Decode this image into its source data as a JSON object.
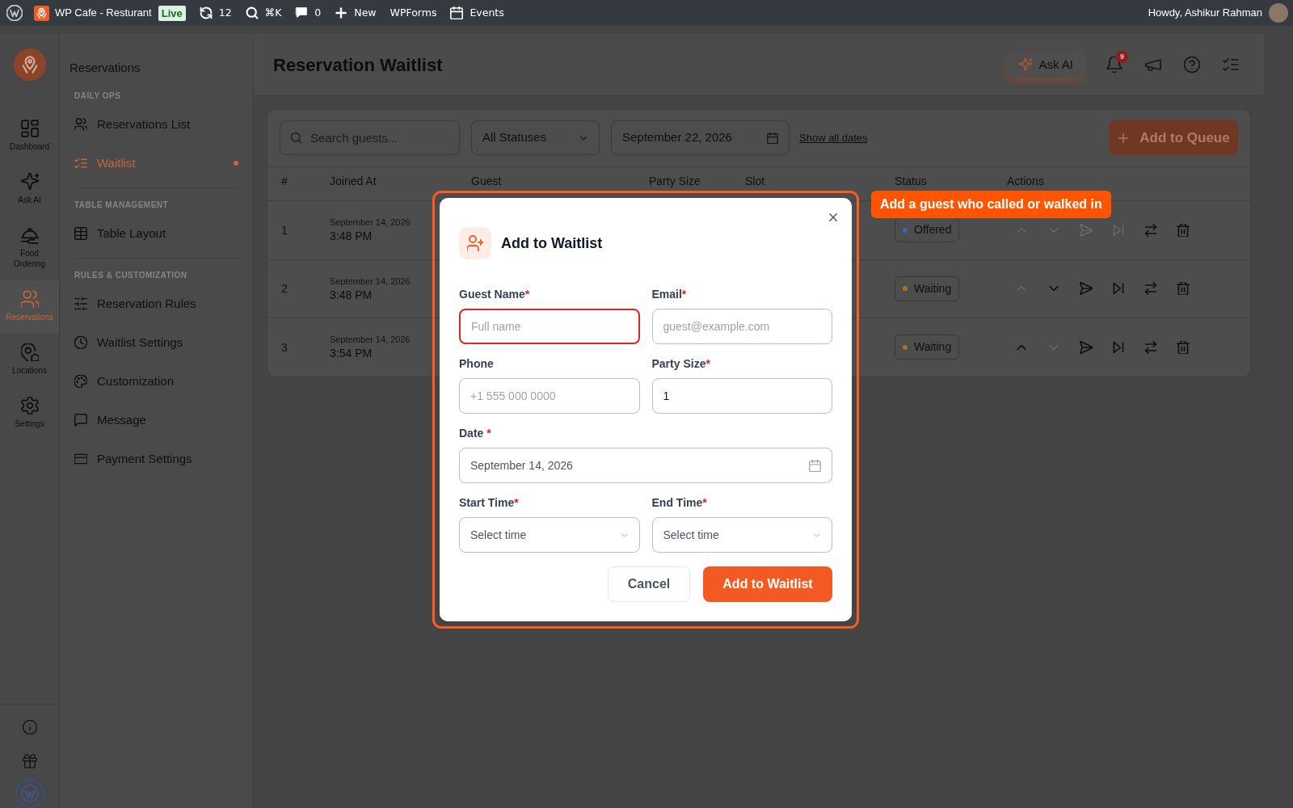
{
  "admin_bar": {
    "site": {
      "name": "WP Cafe - Resturant",
      "badge": "Live"
    },
    "items": [
      {
        "kind": "updates",
        "label": "12"
      },
      {
        "kind": "search",
        "label": "⌘K"
      },
      {
        "kind": "comments",
        "label": "0"
      },
      {
        "kind": "new",
        "label": "New"
      },
      {
        "kind": "link",
        "label": "WPForms"
      },
      {
        "kind": "events",
        "label": "Events"
      }
    ],
    "greeting": "Howdy, Ashikur Rahman"
  },
  "rail": {
    "items": [
      {
        "label": "Dashboard",
        "selected": false
      },
      {
        "label": "Ask AI",
        "selected": false
      },
      {
        "label": "Food Ordering",
        "selected": false
      },
      {
        "label": "Reservations",
        "selected": true
      },
      {
        "label": "Locations",
        "selected": false
      },
      {
        "label": "Settings",
        "selected": false
      }
    ]
  },
  "sidebar": {
    "title": "Reservations",
    "sections": [
      {
        "heading": "DAILY OPS",
        "items": [
          {
            "label": "Reservations List",
            "selected": false
          },
          {
            "label": "Waitlist",
            "selected": true
          }
        ]
      },
      {
        "heading": "TABLE MANAGEMENT",
        "items": [
          {
            "label": "Table Layout",
            "selected": false
          }
        ]
      },
      {
        "heading": "RULES & CUSTOMIZATION",
        "items": [
          {
            "label": "Reservation Rules",
            "selected": false
          },
          {
            "label": "Waitlist Settings",
            "selected": false
          },
          {
            "label": "Customization",
            "selected": false
          },
          {
            "label": "Message",
            "selected": false
          },
          {
            "label": "Payment Settings",
            "selected": false
          }
        ]
      }
    ]
  },
  "header": {
    "title": "Reservation Waitlist",
    "ask_ai": "Ask AI",
    "notification_count": "9"
  },
  "toolbar": {
    "search": {
      "placeholder": "Search guests..."
    },
    "status_filter": "All Statuses",
    "date_filter": "September 22, 2026",
    "show_all_dates": "Show all dates",
    "add_button": "Add to Queue"
  },
  "table": {
    "columns": [
      "#",
      "Joined At",
      "Guest",
      "Party Size",
      "Slot",
      "Status",
      "Actions"
    ],
    "rows": [
      {
        "number": "1",
        "joined_date": "September 14, 2026",
        "joined_time": "3:48 PM",
        "status": {
          "label": "Offered",
          "color": "#4263b8"
        },
        "actions": [
          {
            "kind": "up",
            "disabled": true
          },
          {
            "kind": "down",
            "disabled": true
          },
          {
            "kind": "send",
            "disabled": true
          },
          {
            "kind": "skip",
            "disabled": true
          },
          {
            "kind": "swap",
            "disabled": false
          },
          {
            "kind": "delete",
            "disabled": false
          }
        ]
      },
      {
        "number": "2",
        "joined_date": "September 14, 2026",
        "joined_time": "3:48 PM",
        "status": {
          "label": "Waiting",
          "color": "#a8731f"
        },
        "actions": [
          {
            "kind": "up",
            "disabled": true
          },
          {
            "kind": "down",
            "disabled": false
          },
          {
            "kind": "send",
            "disabled": false
          },
          {
            "kind": "skip",
            "disabled": false
          },
          {
            "kind": "swap",
            "disabled": false
          },
          {
            "kind": "delete",
            "disabled": false
          }
        ]
      },
      {
        "number": "3",
        "joined_date": "September 14, 2026",
        "joined_time": "3:54 PM",
        "status": {
          "label": "Waiting",
          "color": "#a8731f"
        },
        "actions": [
          {
            "kind": "up",
            "disabled": false
          },
          {
            "kind": "down",
            "disabled": true
          },
          {
            "kind": "send",
            "disabled": false
          },
          {
            "kind": "skip",
            "disabled": false
          },
          {
            "kind": "swap",
            "disabled": false
          },
          {
            "kind": "delete",
            "disabled": false
          }
        ]
      }
    ]
  },
  "modal": {
    "title": "Add to Waitlist",
    "fields": [
      {
        "kind": "text",
        "label": "Guest Name",
        "required_mark": "*",
        "placeholder": "Full name",
        "invalid": true
      },
      {
        "kind": "text",
        "label": "Email",
        "required_mark": "*",
        "placeholder": "guest@example.com",
        "invalid": false
      },
      {
        "kind": "text",
        "label": "Phone",
        "placeholder": "+1 555 000 0000",
        "invalid": false
      },
      {
        "kind": "text",
        "label": "Party Size",
        "required_mark": "*",
        "value": "1",
        "invalid": false
      },
      {
        "kind": "date",
        "label": "Date",
        "required_mark": " *",
        "value": "September 14, 2026",
        "invalid": false
      },
      {
        "kind": "select",
        "label": "Start Time",
        "required_mark": "*",
        "placeholder": "Select time",
        "invalid": false
      },
      {
        "kind": "select",
        "label": "End Time",
        "required_mark": "*",
        "placeholder": "Select time",
        "invalid": false
      }
    ],
    "buttons": [
      {
        "kind": "secondary",
        "label": "Cancel"
      },
      {
        "kind": "primary",
        "label": "Add to Waitlist"
      }
    ]
  },
  "tour": {
    "callout": "Add a guest who called or walked in"
  }
}
